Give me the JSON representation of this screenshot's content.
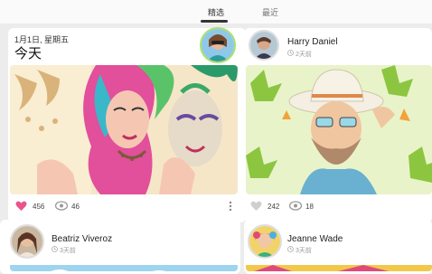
{
  "tabs": [
    {
      "label": "精选",
      "active": true
    },
    {
      "label": "最近",
      "active": false
    }
  ],
  "feed_header": {
    "date": "1月1日, 星期五",
    "title": "今天"
  },
  "cards": [
    {
      "likes": "456",
      "views": "46"
    },
    {
      "author": "Harry Daniel",
      "time_ago": "2天前",
      "likes": "242",
      "views": "18"
    },
    {
      "author": "Beatriz Viveroz",
      "time_ago": "3天前"
    },
    {
      "author": "Jeanne Wade",
      "time_ago": "3天前"
    }
  ],
  "colors": {
    "accent_green": "#a8e06a",
    "like_pink": "#e8558c",
    "background": "#ececec"
  }
}
